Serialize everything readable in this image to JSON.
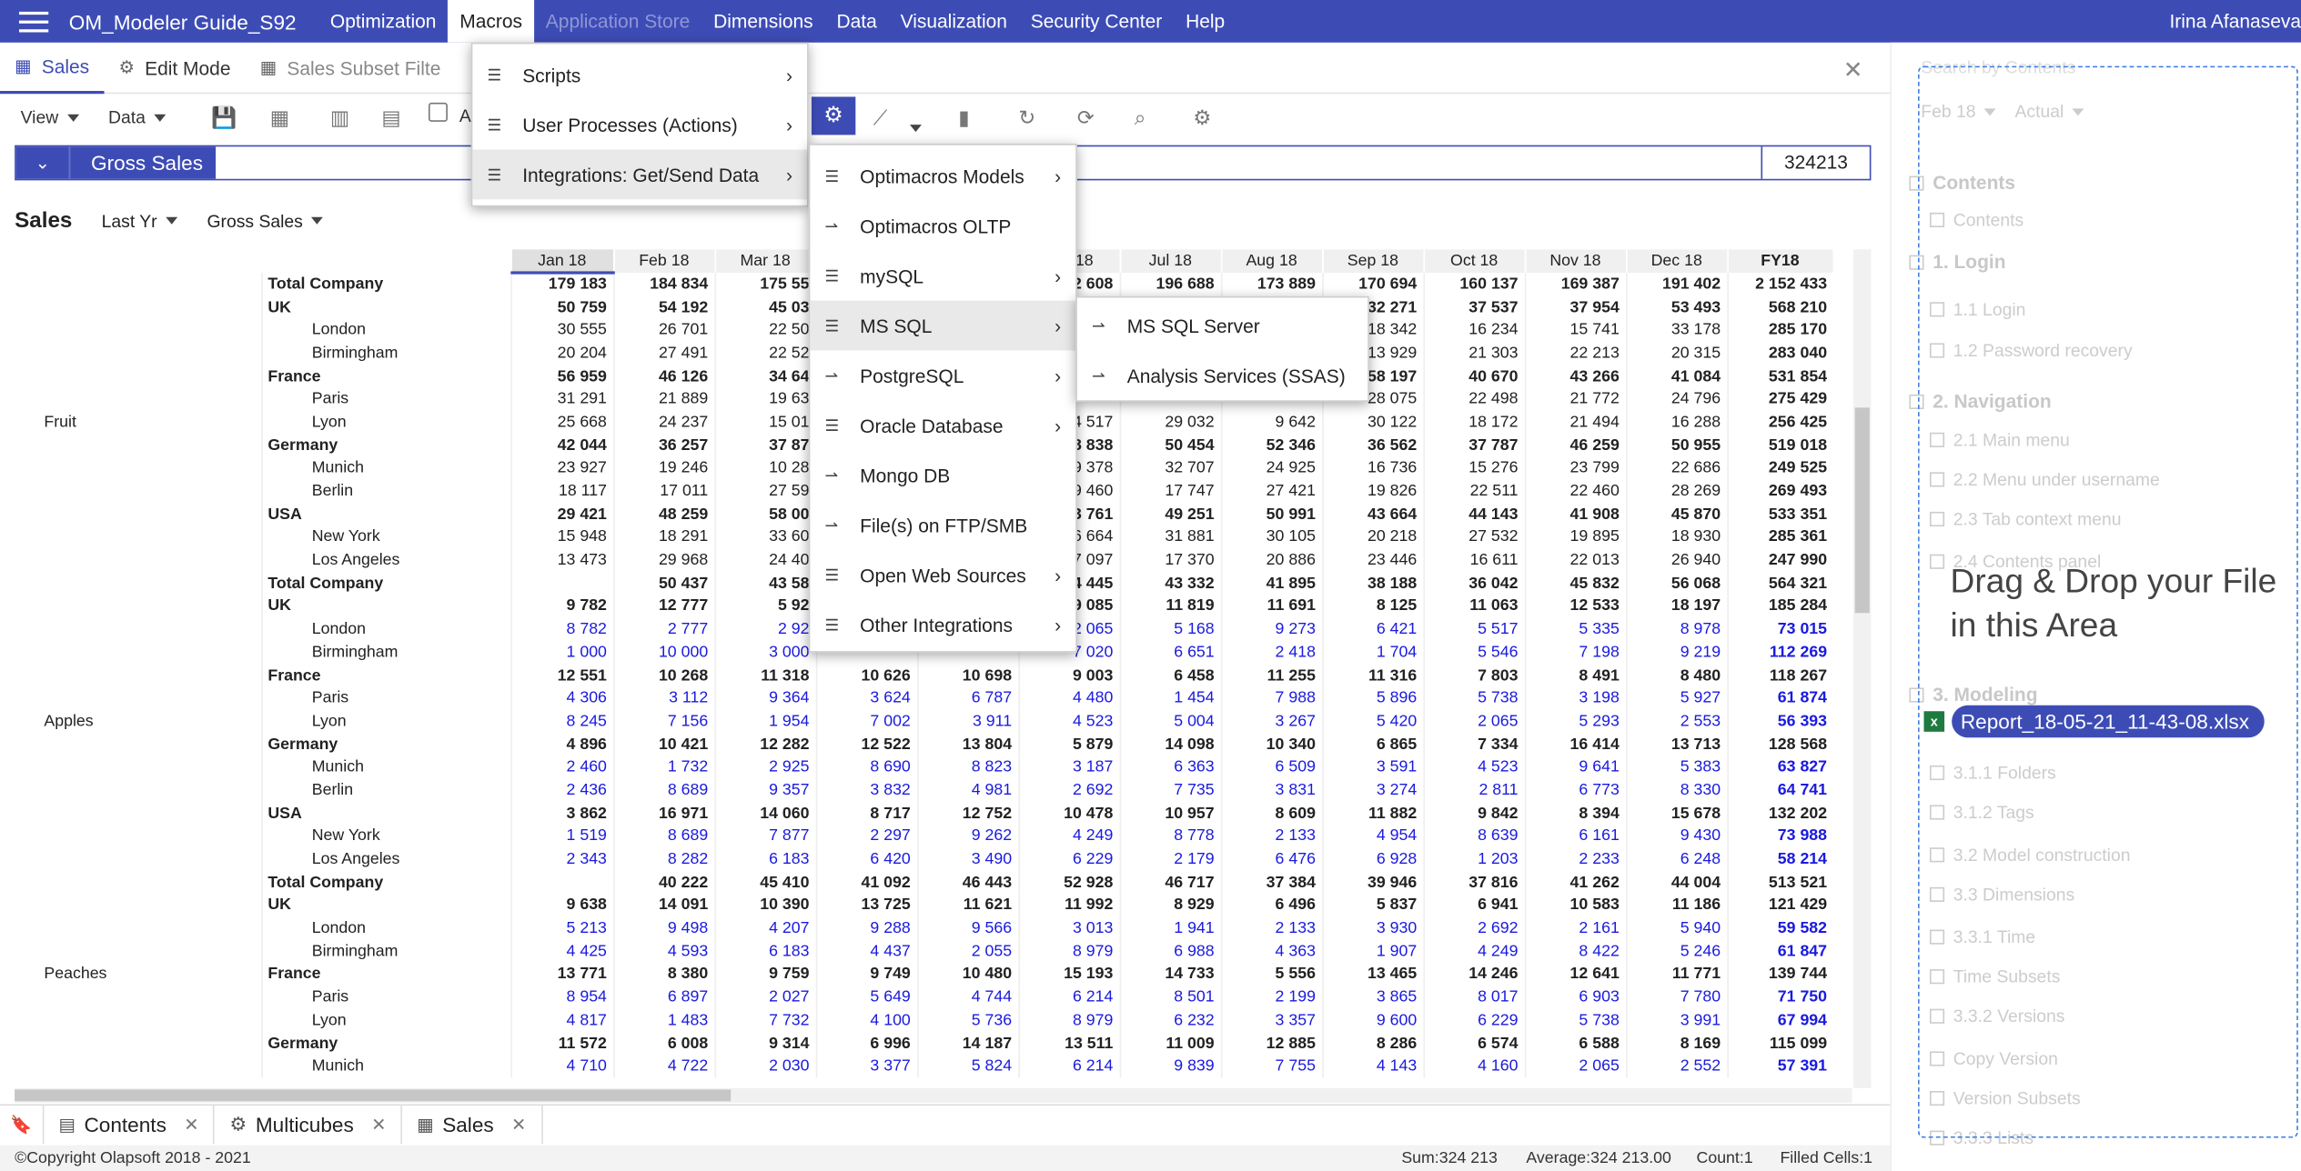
{
  "app": {
    "title": "OM_Modeler Guide_S92",
    "user": "Irina Afanaseva"
  },
  "menu": [
    "Optimization",
    "Macros",
    "Application Store",
    "Dimensions",
    "Data",
    "Visualization",
    "Security Center",
    "Help"
  ],
  "tabs": {
    "sales": "Sales",
    "edit_mode": "Edit Mode",
    "subset": "Sales Subset Filte"
  },
  "toolbar": {
    "view": "View",
    "data": "Data",
    "partial": "A"
  },
  "formula": {
    "name": "Gross Sales",
    "value": "324213"
  },
  "view_header": {
    "title": "Sales",
    "filter1": "Last Yr",
    "filter2": "Gross Sales"
  },
  "columns": [
    "Jan 18",
    "Feb 18",
    "Mar 18",
    "Apr 18",
    "May 18",
    "Jun 18",
    "Jul 18",
    "Aug 18",
    "Sep 18",
    "Oct 18",
    "Nov 18",
    "Dec 18",
    "FY18"
  ],
  "groups": [
    "Fruit",
    "Apples",
    "Peaches"
  ],
  "rows": [
    {
      "g": 0,
      "t": "b",
      "label": "Total Company",
      "v": [
        "179 183",
        "184 834",
        "175 55",
        "",
        "",
        "52 608",
        "196 688",
        "173 889",
        "170 694",
        "160 137",
        "169 387",
        "191 402",
        "2 152 433"
      ]
    },
    {
      "g": 0,
      "t": "b",
      "label": "UK",
      "v": [
        "50 759",
        "54 192",
        "45 03",
        "",
        "",
        "",
        "",
        "",
        "32 271",
        "37 537",
        "37 954",
        "53 493",
        "568 210"
      ]
    },
    {
      "g": 0,
      "t": "f",
      "label": "London",
      "v": [
        "30 555",
        "26 701",
        "22 50",
        "",
        "",
        "",
        "",
        "",
        "18 342",
        "16 234",
        "15 741",
        "33 178",
        "285 170"
      ]
    },
    {
      "g": 0,
      "t": "f",
      "label": "Birmingham",
      "v": [
        "20 204",
        "27 491",
        "22 52",
        "",
        "",
        "",
        "",
        "",
        "13 929",
        "21 303",
        "22 213",
        "20 315",
        "283 040"
      ]
    },
    {
      "g": 0,
      "t": "b",
      "label": "France",
      "v": [
        "56 959",
        "46 126",
        "34 64",
        "",
        "",
        "",
        "",
        "",
        "58 197",
        "40 670",
        "43 266",
        "41 084",
        "531 854"
      ]
    },
    {
      "g": 0,
      "t": "f",
      "label": "Paris",
      "v": [
        "31 291",
        "21 889",
        "19 63",
        "",
        "",
        "",
        "",
        "",
        "28 075",
        "22 498",
        "21 772",
        "24 796",
        "275 429"
      ]
    },
    {
      "g": 0,
      "t": "f",
      "label": "Lyon",
      "v": [
        "25 668",
        "24 237",
        "15 01",
        "",
        "",
        "24 517",
        "29 032",
        "9 642",
        "30 122",
        "18 172",
        "21 494",
        "16 288",
        "256 425"
      ]
    },
    {
      "g": 0,
      "t": "b",
      "label": "Germany",
      "v": [
        "42 044",
        "36 257",
        "37 87",
        "",
        "",
        "38 838",
        "50 454",
        "52 346",
        "36 562",
        "37 787",
        "46 259",
        "50 955",
        "519 018"
      ]
    },
    {
      "g": 0,
      "t": "f",
      "label": "Munich",
      "v": [
        "23 927",
        "19 246",
        "10 28",
        "",
        "",
        "9 378",
        "32 707",
        "24 925",
        "16 736",
        "15 276",
        "23 799",
        "22 686",
        "249 525"
      ]
    },
    {
      "g": 0,
      "t": "f",
      "label": "Berlin",
      "v": [
        "18 117",
        "17 011",
        "27 59",
        "",
        "",
        "9 460",
        "17 747",
        "27 421",
        "19 826",
        "22 511",
        "22 460",
        "28 269",
        "269 493"
      ]
    },
    {
      "g": 0,
      "t": "b",
      "label": "USA",
      "v": [
        "29 421",
        "48 259",
        "58 00",
        "",
        "",
        "43 761",
        "49 251",
        "50 991",
        "43 664",
        "44 143",
        "41 908",
        "45 870",
        "533 351"
      ]
    },
    {
      "g": 0,
      "t": "f",
      "label": "New York",
      "v": [
        "15 948",
        "18 291",
        "33 60",
        "",
        "",
        "16 664",
        "31 881",
        "30 105",
        "20 218",
        "27 532",
        "19 895",
        "18 930",
        "285 361"
      ]
    },
    {
      "g": 0,
      "t": "f",
      "label": "Los Angeles",
      "v": [
        "13 473",
        "29 968",
        "24 40",
        "",
        "",
        "27 097",
        "17 370",
        "20 886",
        "23 446",
        "16 611",
        "22 013",
        "26 940",
        "247 990"
      ]
    },
    {
      "g": 1,
      "t": "b",
      "label": "Total Company",
      "v": [
        "",
        "50 437",
        "43 58",
        "",
        "",
        "34 445",
        "43 332",
        "41 895",
        "38 188",
        "36 042",
        "45 832",
        "56 068",
        "564 321"
      ]
    },
    {
      "g": 1,
      "t": "b",
      "label": "UK",
      "v": [
        "9 782",
        "12 777",
        "5 92",
        "",
        "",
        "9 085",
        "11 819",
        "11 691",
        "8 125",
        "11 063",
        "12 533",
        "18 197",
        "185 284"
      ]
    },
    {
      "g": 1,
      "t": "s",
      "label": "London",
      "v": [
        "8 782",
        "2 777",
        "2 92",
        "",
        "",
        "2 065",
        "5 168",
        "9 273",
        "6 421",
        "5 517",
        "5 335",
        "8 978",
        "73 015"
      ]
    },
    {
      "g": 1,
      "t": "s",
      "label": "Birmingham",
      "v": [
        "1 000",
        "10 000",
        "3 000",
        "",
        "",
        "7 020",
        "6 651",
        "2 418",
        "1 704",
        "5 546",
        "7 198",
        "9 219",
        "112 269"
      ]
    },
    {
      "g": 1,
      "t": "b",
      "label": "France",
      "v": [
        "12 551",
        "10 268",
        "11 318",
        "10 626",
        "10 698",
        "9 003",
        "6 458",
        "11 255",
        "11 316",
        "7 803",
        "8 491",
        "8 480",
        "118 267"
      ]
    },
    {
      "g": 1,
      "t": "s",
      "label": "Paris",
      "v": [
        "4 306",
        "3 112",
        "9 364",
        "3 624",
        "6 787",
        "4 480",
        "1 454",
        "7 988",
        "5 896",
        "5 738",
        "3 198",
        "5 927",
        "61 874"
      ]
    },
    {
      "g": 1,
      "t": "s",
      "label": "Lyon",
      "v": [
        "8 245",
        "7 156",
        "1 954",
        "7 002",
        "3 911",
        "4 523",
        "5 004",
        "3 267",
        "5 420",
        "2 065",
        "5 293",
        "2 553",
        "56 393"
      ]
    },
    {
      "g": 1,
      "t": "b",
      "label": "Germany",
      "v": [
        "4 896",
        "10 421",
        "12 282",
        "12 522",
        "13 804",
        "5 879",
        "14 098",
        "10 340",
        "6 865",
        "7 334",
        "16 414",
        "13 713",
        "128 568"
      ]
    },
    {
      "g": 1,
      "t": "s",
      "label": "Munich",
      "v": [
        "2 460",
        "1 732",
        "2 925",
        "8 690",
        "8 823",
        "3 187",
        "6 363",
        "6 509",
        "3 591",
        "4 523",
        "9 641",
        "5 383",
        "63 827"
      ]
    },
    {
      "g": 1,
      "t": "s",
      "label": "Berlin",
      "v": [
        "2 436",
        "8 689",
        "9 357",
        "3 832",
        "4 981",
        "2 692",
        "7 735",
        "3 831",
        "3 274",
        "2 811",
        "6 773",
        "8 330",
        "64 741"
      ]
    },
    {
      "g": 1,
      "t": "b",
      "label": "USA",
      "v": [
        "3 862",
        "16 971",
        "14 060",
        "8 717",
        "12 752",
        "10 478",
        "10 957",
        "8 609",
        "11 882",
        "9 842",
        "8 394",
        "15 678",
        "132 202"
      ]
    },
    {
      "g": 1,
      "t": "s",
      "label": "New York",
      "v": [
        "1 519",
        "8 689",
        "7 877",
        "2 297",
        "9 262",
        "4 249",
        "8 778",
        "2 133",
        "4 954",
        "8 639",
        "6 161",
        "9 430",
        "73 988"
      ]
    },
    {
      "g": 1,
      "t": "s",
      "label": "Los Angeles",
      "v": [
        "2 343",
        "8 282",
        "6 183",
        "6 420",
        "3 490",
        "6 229",
        "2 179",
        "6 476",
        "6 928",
        "1 203",
        "2 233",
        "6 248",
        "58 214"
      ]
    },
    {
      "g": 2,
      "t": "b",
      "label": "Total Company",
      "v": [
        "",
        "40 222",
        "45 410",
        "41 092",
        "46 443",
        "52 928",
        "46 717",
        "37 384",
        "39 946",
        "37 816",
        "41 262",
        "44 004",
        "513 521"
      ]
    },
    {
      "g": 2,
      "t": "b",
      "label": "UK",
      "v": [
        "9 638",
        "14 091",
        "10 390",
        "13 725",
        "11 621",
        "11 992",
        "8 929",
        "6 496",
        "5 837",
        "6 941",
        "10 583",
        "11 186",
        "121 429"
      ]
    },
    {
      "g": 2,
      "t": "s",
      "label": "London",
      "v": [
        "5 213",
        "9 498",
        "4 207",
        "9 288",
        "9 566",
        "3 013",
        "1 941",
        "2 133",
        "3 930",
        "2 692",
        "2 161",
        "5 940",
        "59 582"
      ]
    },
    {
      "g": 2,
      "t": "s",
      "label": "Birmingham",
      "v": [
        "4 425",
        "4 593",
        "6 183",
        "4 437",
        "2 055",
        "8 979",
        "6 988",
        "4 363",
        "1 907",
        "4 249",
        "8 422",
        "5 246",
        "61 847"
      ]
    },
    {
      "g": 2,
      "t": "b",
      "label": "France",
      "v": [
        "13 771",
        "8 380",
        "9 759",
        "9 749",
        "10 480",
        "15 193",
        "14 733",
        "5 556",
        "13 465",
        "14 246",
        "12 641",
        "11 771",
        "139 744"
      ]
    },
    {
      "g": 2,
      "t": "s",
      "label": "Paris",
      "v": [
        "8 954",
        "6 897",
        "2 027",
        "5 649",
        "4 744",
        "6 214",
        "8 501",
        "2 199",
        "3 865",
        "8 017",
        "6 903",
        "7 780",
        "71 750"
      ]
    },
    {
      "g": 2,
      "t": "s",
      "label": "Lyon",
      "v": [
        "4 817",
        "1 483",
        "7 732",
        "4 100",
        "5 736",
        "8 979",
        "6 232",
        "3 357",
        "9 600",
        "6 229",
        "5 738",
        "3 991",
        "67 994"
      ]
    },
    {
      "g": 2,
      "t": "b",
      "label": "Germany",
      "v": [
        "11 572",
        "6 008",
        "9 314",
        "6 996",
        "14 187",
        "13 511",
        "11 009",
        "12 885",
        "8 286",
        "6 574",
        "6 588",
        "8 169",
        "115 099"
      ]
    },
    {
      "g": 2,
      "t": "s",
      "label": "Munich",
      "v": [
        "4 710",
        "4 722",
        "2 030",
        "3 377",
        "5 824",
        "6 214",
        "9 839",
        "7 755",
        "4 143",
        "4 160",
        "2 065",
        "2 552",
        "57 391"
      ]
    }
  ],
  "macros_menu": [
    {
      "label": "Scripts",
      "arrow": true
    },
    {
      "label": "User Processes (Actions)",
      "arrow": true
    },
    {
      "label": "Integrations: Get/Send Data",
      "arrow": true
    }
  ],
  "integrations_menu": [
    {
      "label": "Optimacros Models",
      "arrow": true,
      "icon": "list"
    },
    {
      "label": "Optimacros OLTP",
      "arrow": false,
      "icon": "link"
    },
    {
      "label": "mySQL",
      "arrow": true,
      "icon": "list"
    },
    {
      "label": "MS SQL",
      "arrow": true,
      "icon": "list"
    },
    {
      "label": "PostgreSQL",
      "arrow": true,
      "icon": "link"
    },
    {
      "label": "Oracle Database",
      "arrow": true,
      "icon": "list"
    },
    {
      "label": "Mongo DB",
      "arrow": false,
      "icon": "link"
    },
    {
      "label": "File(s) on FTP/SMB",
      "arrow": false,
      "icon": "link"
    },
    {
      "label": "Open Web Sources",
      "arrow": true,
      "icon": "list"
    },
    {
      "label": "Other Integrations",
      "arrow": true,
      "icon": "list"
    }
  ],
  "mssql_menu": [
    "MS SQL Server",
    "Analysis Services (SSAS)"
  ],
  "bottom_tabs": [
    "Contents",
    "Multicubes",
    "Sales"
  ],
  "status": {
    "copyright": "©Copyright Olapsoft 2018 - 2021",
    "sum": "Sum:324 213",
    "average": "Average:324 213.00",
    "count": "Count:1",
    "filled": "Filled Cells:1"
  },
  "side_panel": {
    "search_placeholder": "Search by Contents",
    "filter1": "Feb 18",
    "filter2": "Actual",
    "items": [
      {
        "label": "Contents",
        "level": 0
      },
      {
        "label": "Contents",
        "level": 1
      },
      {
        "label": "1. Login",
        "level": 0
      },
      {
        "label": "1.1 Login",
        "level": 1
      },
      {
        "label": "1.2 Password recovery",
        "level": 1
      },
      {
        "label": "2. Navigation",
        "level": 0
      },
      {
        "label": "2.1 Main menu",
        "level": 1
      },
      {
        "label": "2.2 Menu under username",
        "level": 1
      },
      {
        "label": "2.3 Tab context menu",
        "level": 1
      },
      {
        "label": "2.4 Contents panel",
        "level": 1
      },
      {
        "label": "3. Modeling",
        "level": 0
      },
      {
        "label": "3.1.1 Folders",
        "level": 1
      },
      {
        "label": "3.1.2 Tags",
        "level": 1
      },
      {
        "label": "3.2 Model construction",
        "level": 1
      },
      {
        "label": "3.3 Dimensions",
        "level": 1
      },
      {
        "label": "3.3.1 Time",
        "level": 1
      },
      {
        "label": "Time Subsets",
        "level": 1
      },
      {
        "label": "3.3.2 Versions",
        "level": 1
      },
      {
        "label": "Copy Version",
        "level": 1
      },
      {
        "label": "Version Subsets",
        "level": 1
      },
      {
        "label": "3.3.3 Lists",
        "level": 1
      }
    ],
    "drop_text": "Drag & Drop your File in this Area",
    "file_name": "Report_18-05-21_11-43-08.xlsx"
  }
}
